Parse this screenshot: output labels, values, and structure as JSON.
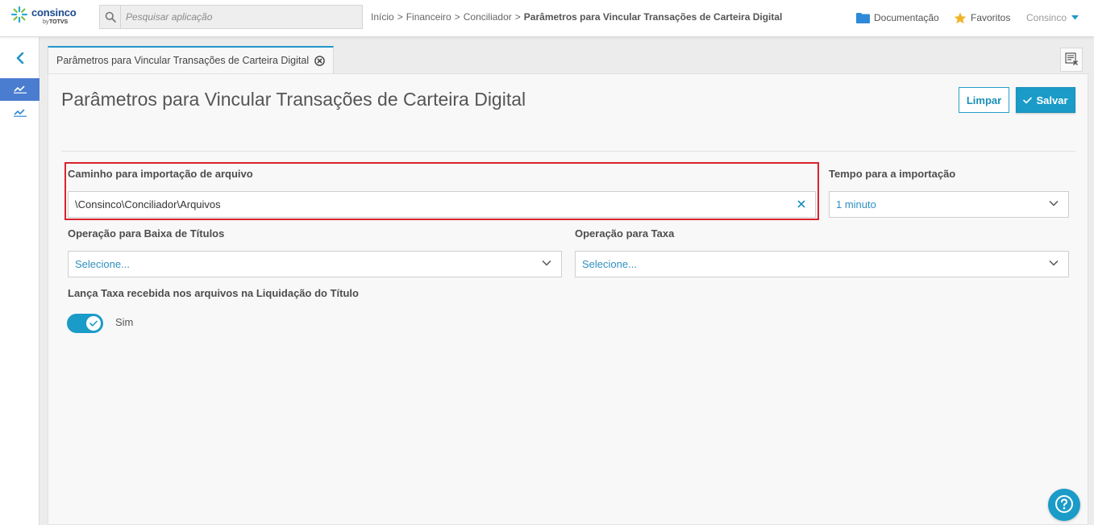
{
  "app": {
    "logo_text": "consinco",
    "logo_by": "by",
    "logo_totvs": "TOTVS"
  },
  "search": {
    "placeholder": "Pesquisar aplicação"
  },
  "breadcrumb": {
    "items": [
      "Início",
      "Financeiro",
      "Conciliador"
    ],
    "separator": ">",
    "current": "Parâmetros para Vincular Transações de Carteira Digital"
  },
  "header": {
    "docs_label": "Documentação",
    "favorites_label": "Favoritos",
    "user_label": "Consinco"
  },
  "tab": {
    "label": "Parâmetros para Vincular Transações de Carteira Digital"
  },
  "page": {
    "title": "Parâmetros para Vincular Transações de Carteira Digital",
    "clear_label": "Limpar",
    "save_label": "Salvar"
  },
  "form": {
    "import_path": {
      "label": "Caminho para importação de arquivo",
      "value": "\\Consinco\\Conciliador\\Arquivos"
    },
    "import_time": {
      "label": "Tempo para a importação",
      "value": "1 minuto"
    },
    "write_off_operation": {
      "label": "Operação para Baixa de Títulos",
      "value": "Selecione..."
    },
    "fee_operation": {
      "label": "Operação para Taxa",
      "value": "Selecione..."
    },
    "fee_toggle": {
      "label": "Lança Taxa recebida nos arquivos na Liquidação do Título",
      "state_label": "Sim",
      "checked": true
    }
  },
  "colors": {
    "accent": "#1a9bc8",
    "highlight": "#d9232e",
    "nav_active": "#4a7ccf"
  }
}
